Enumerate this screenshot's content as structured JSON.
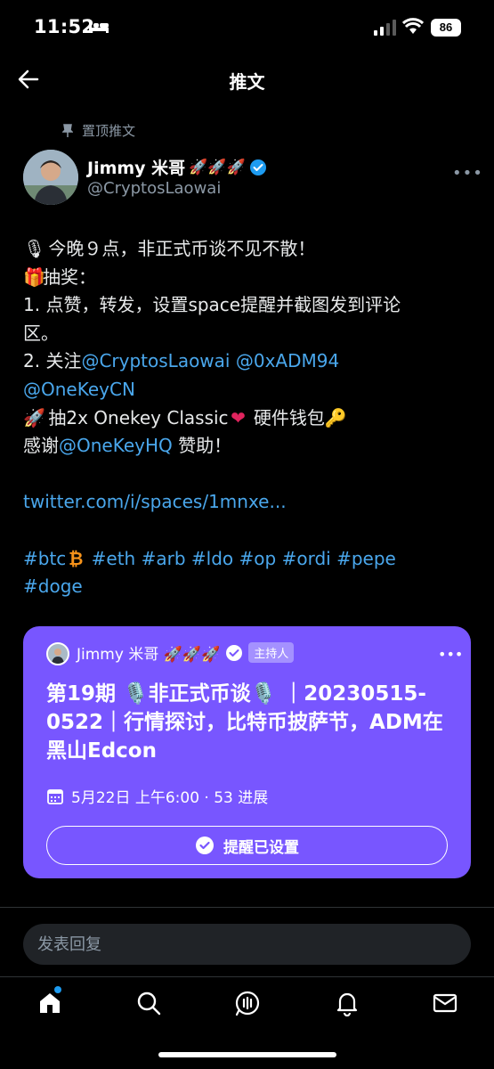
{
  "status_bar": {
    "time": "11:52",
    "battery": "86"
  },
  "header": {
    "title": "推文"
  },
  "tweet": {
    "pinned_label": "置顶推文",
    "author": {
      "name": "Jimmy 米哥",
      "name_emojis": "🚀🚀🚀",
      "handle": "@CryptosLaowai"
    },
    "body": {
      "line1": "今晚９点，非正式币谈不见不散！",
      "line2": "抽奖：",
      "line3": "1. 点赞，转发，设置space提醒并截图发到评论",
      "line4": "区。",
      "line5_prefix": "2. 关注",
      "mention1": "@CryptosLaowai",
      "mention2": "@0xADM94",
      "mention3": "@OneKeyCN",
      "line7": "抽2x Onekey Classic",
      "line7_suffix": "硬件钱包",
      "line8_prefix": "感谢",
      "mention4": "@OneKeyHQ",
      "line8_suffix": " 赞助！",
      "url": "twitter.com/i/spaces/1mnxe...",
      "hashtags_line1": [
        "#btc",
        "#eth",
        "#arb",
        "#ldo",
        "#op",
        "#ordi",
        "#pepe"
      ],
      "hashtag_doge": "#doge"
    }
  },
  "space_card": {
    "host_name": "Jimmy 米哥 🚀🚀🚀",
    "host_badge": "主持人",
    "title": "第19期 🎙️非正式币谈🎙️ ｜20230515-0522｜行情探讨，比特币披萨节，ADM在黑山Edcon",
    "meta": "5月22日 上午6:00 · 53 进展",
    "reminder_label": "提醒已设置"
  },
  "reply": {
    "placeholder": "发表回复"
  },
  "colors": {
    "accent": "#1d9bf0",
    "link": "#4aa7ec",
    "space": "#7856ff"
  },
  "icons": [
    "back-arrow-icon",
    "pin-icon",
    "verified-icon",
    "more-icon",
    "calendar-icon",
    "check-circle-icon",
    "home-icon",
    "search-icon",
    "spaces-icon",
    "bell-icon",
    "mail-icon"
  ]
}
